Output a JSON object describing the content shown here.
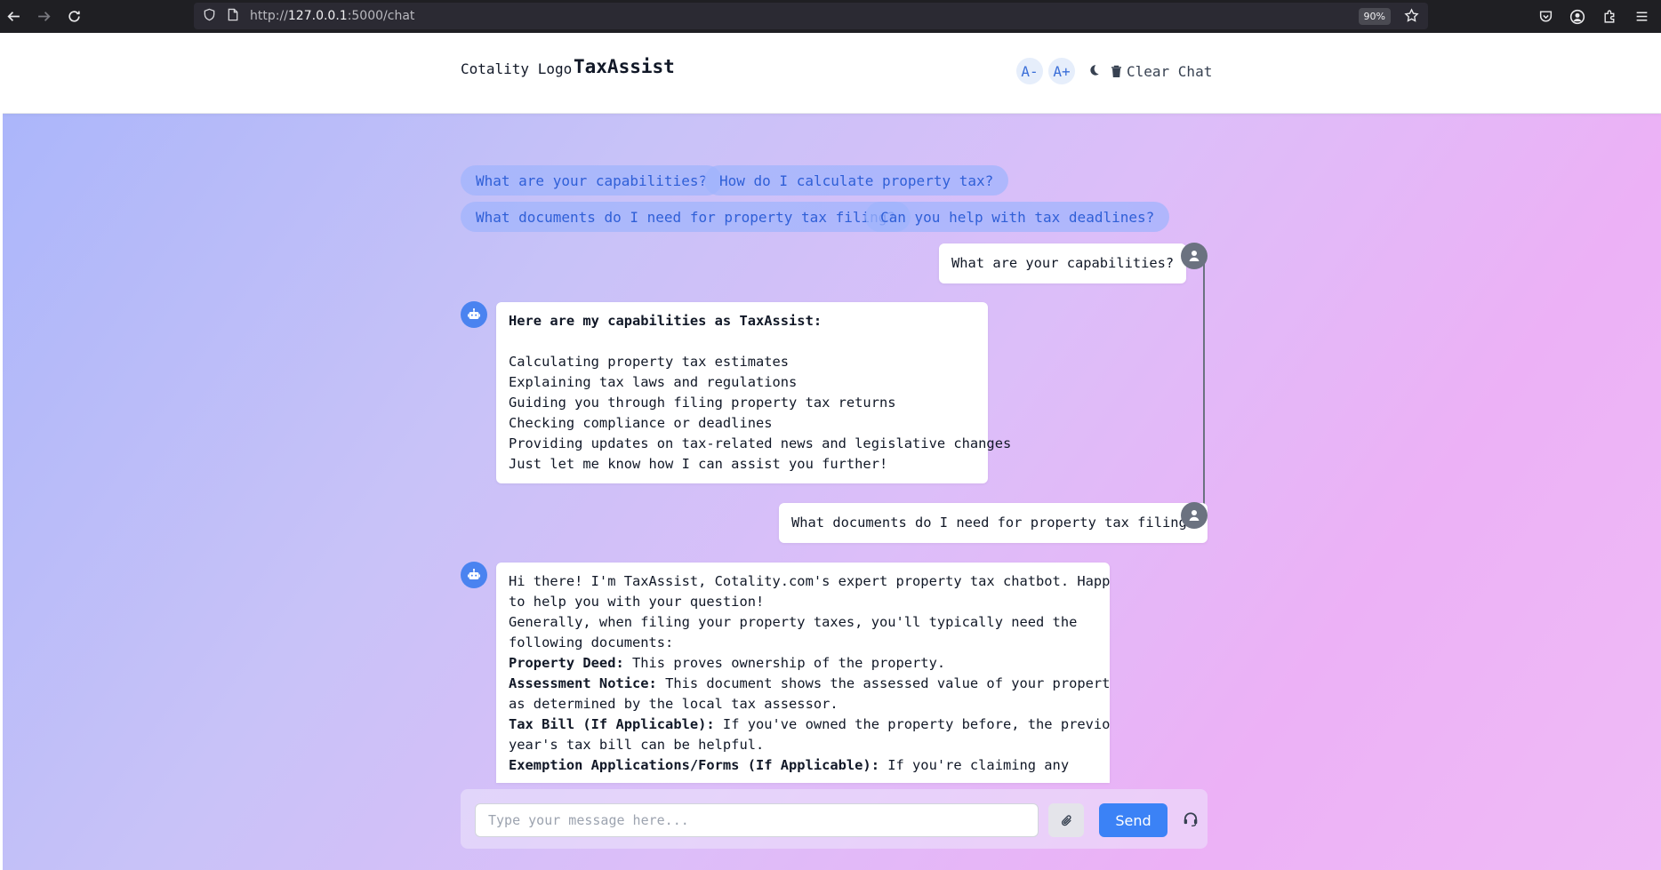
{
  "browser": {
    "url_prefix": "http://",
    "url_host": "127.0.0.1",
    "url_path": ":5000/chat",
    "zoom": "90%"
  },
  "header": {
    "logo_alt": "Cotality Logo",
    "title": "TaxAssist",
    "font_decrease": "A-",
    "font_increase": "A+",
    "clear_chat": "Clear Chat"
  },
  "suggestions": [
    "What are your capabilities?",
    "How do I calculate property tax?",
    "What documents do I need for property tax filing?",
    "Can you help with tax deadlines?"
  ],
  "messages": [
    {
      "role": "user",
      "text": "What are your capabilities?"
    },
    {
      "role": "bot",
      "heading": "Here are my capabilities as TaxAssist:",
      "items": [
        "Calculating property tax estimates",
        "Explaining tax laws and regulations",
        "Guiding you through filing property tax returns",
        "Checking compliance or deadlines",
        "Providing updates on tax-related news and legislative changes",
        "Just let me know how I can assist you further!"
      ]
    },
    {
      "role": "user",
      "text": "What documents do I need for property tax filing?"
    },
    {
      "role": "bot",
      "intro_lines": [
        "Hi there! I'm TaxAssist, Cotality.com's expert property tax chatbot. Happy",
        "to help you with your question!",
        "Generally, when filing your property taxes, you'll typically need the",
        "following documents:"
      ],
      "docs": [
        {
          "label": "Property Deed:",
          "lines": [
            " This proves ownership of the property."
          ]
        },
        {
          "label": "Assessment Notice:",
          "lines": [
            " This document shows the assessed value of your property",
            "as determined by the local tax assessor."
          ]
        },
        {
          "label": "Tax Bill (If Applicable):",
          "lines": [
            " If you've owned the property before, the previous",
            "year's tax bill can be helpful."
          ]
        },
        {
          "label": "Exemption Applications/Forms (If Applicable):",
          "lines": [
            " If you're claiming any"
          ]
        }
      ]
    }
  ],
  "composer": {
    "placeholder": "Type your message here...",
    "send_label": "Send"
  },
  "colors": {
    "accent": "#3b82f6",
    "suggestion_text": "#2f5fd7",
    "bot_avatar": "#4a83f0",
    "user_avatar": "#6b7280"
  }
}
